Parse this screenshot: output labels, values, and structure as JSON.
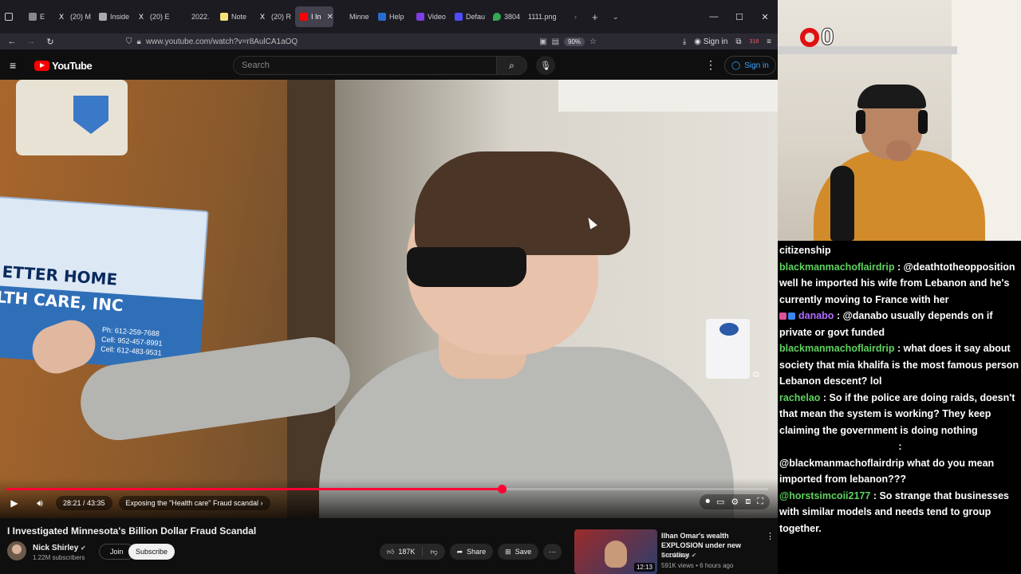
{
  "browser": {
    "tabs": [
      {
        "label": "",
        "color": "#888888"
      },
      {
        "label": "E",
        "color": "#888888"
      },
      {
        "label": "(20) M",
        "color": "#ffffff"
      },
      {
        "label": "Inside",
        "color": "#aaaaaa"
      },
      {
        "label": "(20) E",
        "color": "#ffffff"
      },
      {
        "label": "2022.",
        "color": "#3a78c8"
      },
      {
        "label": "Note",
        "color": "#f7e37a"
      },
      {
        "label": "(20) R",
        "color": "#ffffff"
      },
      {
        "label": "I In",
        "color": "#ff0000",
        "active": true
      },
      {
        "label": "Minne",
        "color": "#1c1b22"
      },
      {
        "label": "Help",
        "color": "#2a6bd1"
      },
      {
        "label": "Video",
        "color": "#7b3fe4"
      },
      {
        "label": "Defau",
        "color": "#4d4dff"
      },
      {
        "label": "3804",
        "color": "#34a853"
      },
      {
        "label": "1111.png",
        "color": "#1c1b22"
      }
    ],
    "url": "www.youtube.com/watch?v=r8AulCA1aOQ",
    "zoom": "90%",
    "sign_in": "Sign in",
    "ext_badge": "318"
  },
  "youtube": {
    "logo_text": "YouTube",
    "search_placeholder": "Search",
    "sign_in": "Sign in"
  },
  "player": {
    "time": "28:21 / 43:35",
    "chapter": "Exposing the \"Health care\" Fraud scandal",
    "progress": 0.65,
    "sign_line1": "ETTER HOME",
    "sign_line2": "LTH CARE, INC",
    "sign_phone1": "Ph: 612-259-7688",
    "sign_phone2": "Cell: 952-457-8991",
    "sign_phone3": "Cell: 612-483-9531"
  },
  "video": {
    "title": "I Investigated Minnesota's Billion Dollar Fraud Scandal",
    "channel": "Nick Shirley",
    "subscribers": "1.22M subscribers",
    "join": "Join",
    "subscribe": "Subscribe",
    "likes": "187K",
    "share": "Share",
    "save": "Save"
  },
  "recommendation": {
    "title": "Ilhan Omar's wealth EXPLOSION under new scrutiny",
    "channel": "Fox News",
    "meta": "591K views • 6 hours ago",
    "duration": "12:13"
  },
  "stream": {
    "counter": "0"
  },
  "chat": [
    {
      "user": "",
      "text": "citizenship"
    },
    {
      "user": "blackmanmachoflairdrip",
      "text": ": @deathtotheopposition well he imported his wife from Lebanon and he's currently moving to France with her"
    },
    {
      "user": "danabo",
      "text": ": @danabo usually depends on if private or govt funded",
      "badges": true
    },
    {
      "user": "blackmanmachoflairdrip",
      "text": ": what does it say about society that mia khalifa is the most famous person Lebanon descent? lol"
    },
    {
      "user": "rachelao",
      "text": ": So if the police are doing raids, doesn't that mean the system is working? They keep claiming the government is doing nothing"
    },
    {
      "user": "",
      "text": ":"
    },
    {
      "user": "",
      "text": "@blackmanmachoflairdrip what do you mean imported from lebanon???"
    },
    {
      "user": "@horstsimcoii2177",
      "text": ": So strange that businesses with similar models and needs tend to group together."
    }
  ]
}
